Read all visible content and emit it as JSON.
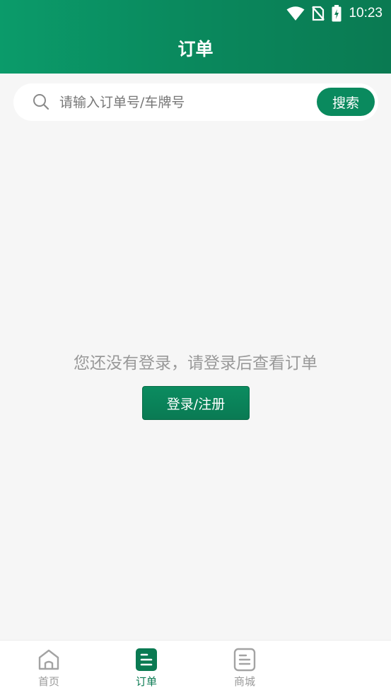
{
  "status_bar": {
    "time": "10:23"
  },
  "header": {
    "title": "订单"
  },
  "search": {
    "placeholder": "请输入订单号/车牌号",
    "value": "",
    "button_label": "搜索"
  },
  "main": {
    "empty_message": "您还没有登录，请登录后查看订单",
    "login_button_label": "登录/注册"
  },
  "tabs": [
    {
      "label": "首页",
      "icon": "home-icon",
      "active": false
    },
    {
      "label": "订单",
      "icon": "order-list-icon",
      "active": true
    },
    {
      "label": "商城",
      "icon": "mall-document-icon",
      "active": false
    }
  ],
  "colors": {
    "accent": "#0a8a5e",
    "header_gradient_start": "#0b9b6a",
    "header_gradient_end": "#0a7a52",
    "background": "#f6f6f6"
  }
}
